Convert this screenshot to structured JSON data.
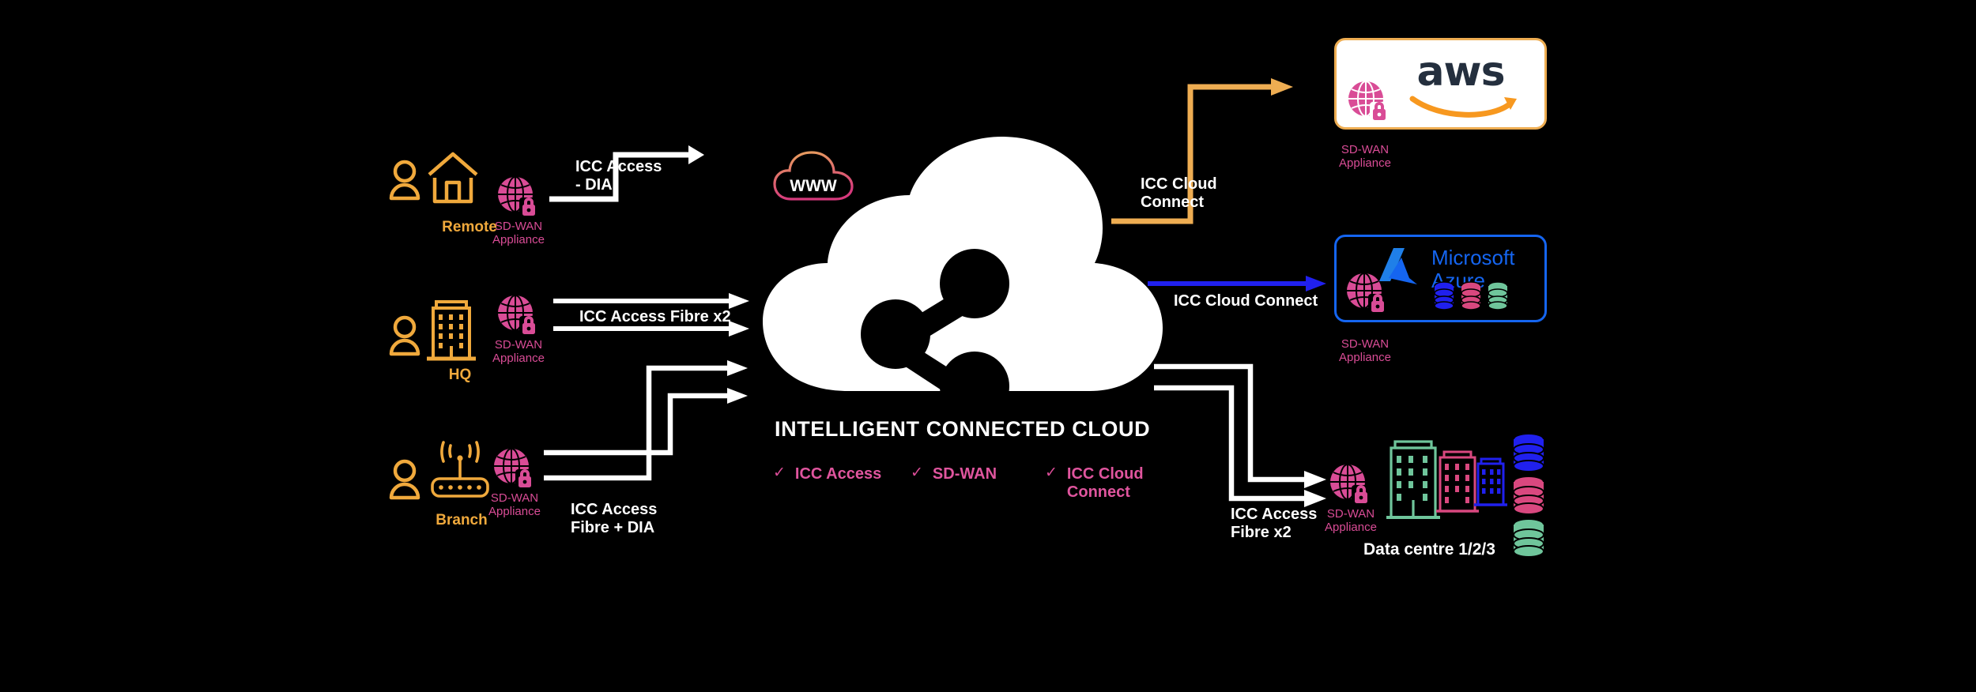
{
  "diagram": {
    "title": "INTELLIGENT CONNECTED CLOUD",
    "background": "#000000",
    "colors": {
      "accent_orange": "#f0a93c",
      "accent_pink": "#d94c96",
      "azure_blue": "#1565f0",
      "link_white": "#ffffff",
      "link_orange": "#eead52",
      "link_blue": "#2020ee",
      "dc_green": "#6fc59b",
      "dc_pink": "#d9487f",
      "dc_blue": "#2020ee"
    }
  },
  "sites": [
    {
      "id": "remote",
      "name": "Remote",
      "user_icon": "person-icon",
      "site_icon": "home-icon",
      "appliance_icon": "globe-lock-icon",
      "appliance_line1": "SD-WAN",
      "appliance_line2": "Appliance"
    },
    {
      "id": "hq",
      "name": "HQ",
      "user_icon": "person-icon",
      "site_icon": "office-building-icon",
      "appliance_icon": "globe-lock-icon",
      "appliance_line1": "SD-WAN",
      "appliance_line2": "Appliance"
    },
    {
      "id": "branch",
      "name": "Branch",
      "user_icon": "person-icon",
      "site_icon": "wifi-router-icon",
      "appliance_icon": "globe-lock-icon",
      "appliance_line1": "SD-WAN",
      "appliance_line2": "Appliance"
    }
  ],
  "links": {
    "remote": {
      "line1": "ICC Access",
      "line2": "- DIA",
      "color": "#ffffff"
    },
    "hq": {
      "line1": "ICC Access Fibre x2",
      "line2": "",
      "color": "#ffffff"
    },
    "branch": {
      "line1": "ICC Access",
      "line2": "Fibre + DIA",
      "color": "#ffffff"
    },
    "aws": {
      "line1": "ICC Cloud",
      "line2": "Connect",
      "color": "#eead52"
    },
    "azure": {
      "line1": "ICC Cloud Connect",
      "line2": "",
      "color": "#2020ee"
    },
    "datacentre": {
      "line1": "ICC Access",
      "line2": "Fibre x2",
      "color": "#ffffff"
    }
  },
  "internet": {
    "label": "WWW",
    "icon": "cloud-outline-icon"
  },
  "cloud": {
    "title": "INTELLIGENT CONNECTED CLOUD",
    "icon": "share-nodes-icon",
    "features": [
      {
        "check": "✓",
        "label": "ICC Access"
      },
      {
        "check": "✓",
        "label": "SD-WAN"
      },
      {
        "check": "✓",
        "label": "ICC Cloud\nConnect",
        "line1": "ICC Cloud",
        "line2": "Connect"
      }
    ]
  },
  "destinations": {
    "aws": {
      "brand": "aws",
      "logo_icon": "aws-smile-icon",
      "appliance_icon": "globe-lock-icon",
      "appliance_line1": "SD-WAN",
      "appliance_line2": "Appliance"
    },
    "azure": {
      "brand_line1": "Microsoft",
      "brand_line2": "Azure",
      "logo_icon": "azure-a-icon",
      "appliance_icon": "globe-lock-icon",
      "appliance_line1": "SD-WAN",
      "appliance_line2": "Appliance",
      "databases": [
        "#2020ee",
        "#d9487f",
        "#6fc59b"
      ]
    },
    "datacentre": {
      "title": "Data centre 1/2/3",
      "appliance_icon": "globe-lock-icon",
      "appliance_line1": "SD-WAN",
      "appliance_line2": "Appliance",
      "buildings": [
        "#6fc59b",
        "#d9487f",
        "#2020ee"
      ],
      "databases": [
        "#2020ee",
        "#d9487f",
        "#6fc59b"
      ]
    }
  }
}
